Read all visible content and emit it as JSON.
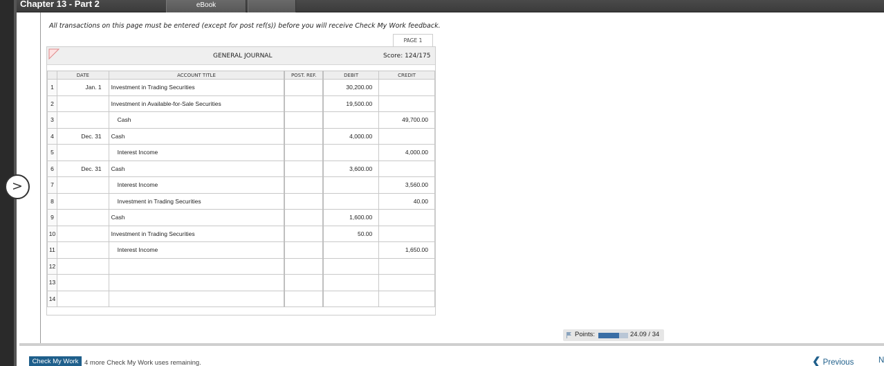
{
  "header": {
    "title": "Chapter 13 - Part 2",
    "tabs": [
      {
        "label": "eBook"
      },
      {
        "label": ""
      }
    ]
  },
  "notice": "All transactions on this page must be entered (except for post ref(s)) before you will receive Check My Work feedback.",
  "journal": {
    "page_label": "PAGE 1",
    "title": "GENERAL JOURNAL",
    "score": "Score: 124/175",
    "columns": {
      "date": "DATE",
      "account": "ACCOUNT TITLE",
      "post_ref": "POST. REF.",
      "debit": "DEBIT",
      "credit": "CREDIT"
    },
    "rows": [
      {
        "num": "1",
        "date": "Jan. 1",
        "account": "Investment in Trading Securities",
        "indent": false,
        "post_ref": "",
        "debit": "30,200.00",
        "credit": ""
      },
      {
        "num": "2",
        "date": "",
        "account": "Investment in Available-for-Sale Securities",
        "indent": false,
        "post_ref": "",
        "debit": "19,500.00",
        "credit": ""
      },
      {
        "num": "3",
        "date": "",
        "account": "Cash",
        "indent": true,
        "post_ref": "",
        "debit": "",
        "credit": "49,700.00"
      },
      {
        "num": "4",
        "date": "Dec. 31",
        "account": "Cash",
        "indent": false,
        "post_ref": "",
        "debit": "4,000.00",
        "credit": ""
      },
      {
        "num": "5",
        "date": "",
        "account": "Interest Income",
        "indent": true,
        "post_ref": "",
        "debit": "",
        "credit": "4,000.00"
      },
      {
        "num": "6",
        "date": "Dec. 31",
        "account": "Cash",
        "indent": false,
        "post_ref": "",
        "debit": "3,600.00",
        "credit": ""
      },
      {
        "num": "7",
        "date": "",
        "account": "Interest Income",
        "indent": true,
        "post_ref": "",
        "debit": "",
        "credit": "3,560.00"
      },
      {
        "num": "8",
        "date": "",
        "account": "Investment in Trading Securities",
        "indent": true,
        "post_ref": "",
        "debit": "",
        "credit": "40.00"
      },
      {
        "num": "9",
        "date": "",
        "account": "Cash",
        "indent": false,
        "post_ref": "",
        "debit": "1,600.00",
        "credit": ""
      },
      {
        "num": "10",
        "date": "",
        "account": "Investment in Trading Securities",
        "indent": false,
        "post_ref": "",
        "debit": "50.00",
        "credit": ""
      },
      {
        "num": "11",
        "date": "",
        "account": "Interest Income",
        "indent": true,
        "post_ref": "",
        "debit": "",
        "credit": "1,650.00"
      },
      {
        "num": "12",
        "date": "",
        "account": "",
        "indent": false,
        "post_ref": "",
        "debit": "",
        "credit": ""
      },
      {
        "num": "13",
        "date": "",
        "account": "",
        "indent": false,
        "post_ref": "",
        "debit": "",
        "credit": ""
      },
      {
        "num": "14",
        "date": "",
        "account": "",
        "indent": false,
        "post_ref": "",
        "debit": "",
        "credit": ""
      }
    ]
  },
  "points": {
    "label": "Points:",
    "value": "24.09 / 34",
    "fraction": 0.7085
  },
  "footer": {
    "check_label": "Check My Work",
    "remaining": "4 more Check My Work uses remaining.",
    "previous": "Previous",
    "next": "N"
  },
  "colors": {
    "accent": "#1f5f8b",
    "progress_fill": "#3a6ea5",
    "topbar": "#3b3b3b"
  },
  "icons": {
    "nav": "chevron-right-icon",
    "corner": "flag-icon",
    "previous": "chevron-left-icon"
  }
}
